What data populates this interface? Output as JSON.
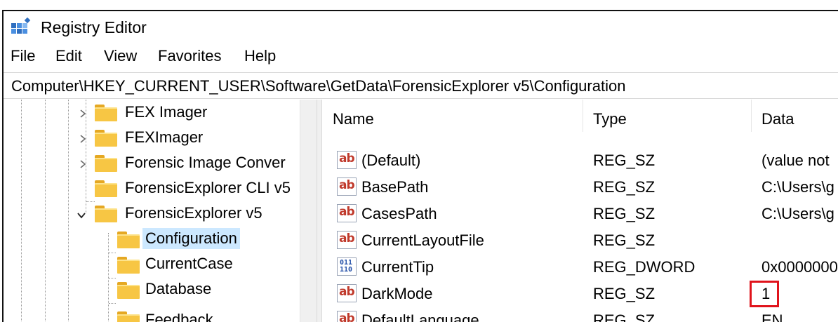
{
  "window": {
    "title": "Registry Editor",
    "icon": "registry-editor-icon"
  },
  "menu": [
    "File",
    "Edit",
    "View",
    "Favorites",
    "Help"
  ],
  "address": "Computer\\HKEY_CURRENT_USER\\Software\\GetData\\ForensicExplorer v5\\Configuration",
  "tree": {
    "items": [
      {
        "label": "FEX Imager",
        "expander": "collapsed"
      },
      {
        "label": "FEXImager",
        "expander": "collapsed"
      },
      {
        "label": "Forensic Image Conver",
        "expander": "collapsed"
      },
      {
        "label": "ForensicExplorer CLI v5",
        "expander": "none"
      },
      {
        "label": "ForensicExplorer v5",
        "expander": "expanded"
      },
      {
        "label": "Configuration",
        "expander": "none",
        "selected": true
      },
      {
        "label": "CurrentCase",
        "expander": "none"
      },
      {
        "label": "Database",
        "expander": "none"
      },
      {
        "label": "Feedback",
        "expander": "none"
      }
    ]
  },
  "list": {
    "columns": [
      "Name",
      "Type",
      "Data"
    ],
    "rows": [
      {
        "icon": "string-value-icon",
        "name": "(Default)",
        "type": "REG_SZ",
        "data": "(value not"
      },
      {
        "icon": "string-value-icon",
        "name": "BasePath",
        "type": "REG_SZ",
        "data": "C:\\Users\\g"
      },
      {
        "icon": "string-value-icon",
        "name": "CasesPath",
        "type": "REG_SZ",
        "data": "C:\\Users\\g"
      },
      {
        "icon": "string-value-icon",
        "name": "CurrentLayoutFile",
        "type": "REG_SZ",
        "data": ""
      },
      {
        "icon": "dword-value-icon",
        "name": "CurrentTip",
        "type": "REG_DWORD",
        "data": "0x0000000"
      },
      {
        "icon": "string-value-icon",
        "name": "DarkMode",
        "type": "REG_SZ",
        "data": "1",
        "highlighted": true
      },
      {
        "icon": "string-value-icon",
        "name": "DefaultLanguage",
        "type": "REG_SZ",
        "data": "EN"
      }
    ]
  },
  "colors": {
    "selection": "#cce8ff",
    "folder": "#f7c644",
    "highlight_box": "#e0131b"
  }
}
